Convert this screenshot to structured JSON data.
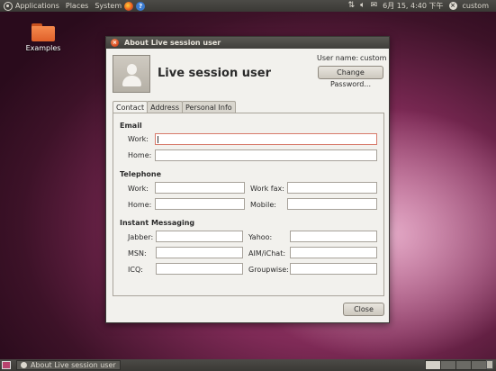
{
  "top_panel": {
    "menus": [
      "Applications",
      "Places",
      "System"
    ],
    "icons": [
      "ubuntu-logo-icon",
      "firefox-icon",
      "help-icon",
      "network-icon",
      "volume-icon",
      "mail-icon",
      "power-icon"
    ],
    "clock": "6月 15, 4:40 下午",
    "user": "custom"
  },
  "desktop": {
    "icons": [
      {
        "label": "Examples",
        "icon": "folder-icon"
      }
    ]
  },
  "dialog": {
    "title": "About Live session user",
    "display_name": "Live session user",
    "username_label": "User name:",
    "username_value": "custom",
    "change_password_label": "Change Password...",
    "tabs": [
      {
        "label": "Contact",
        "active": true
      },
      {
        "label": "Address",
        "active": false
      },
      {
        "label": "Personal Info",
        "active": false
      }
    ],
    "contact": {
      "email_section": "Email",
      "work_label": "Work:",
      "home_label": "Home:",
      "email_work": "",
      "email_home": "",
      "telephone_section": "Telephone",
      "tel_work_label": "Work:",
      "tel_home_label": "Home:",
      "tel_workfax_label": "Work fax:",
      "tel_mobile_label": "Mobile:",
      "im_section": "Instant Messaging",
      "jabber_label": "Jabber:",
      "msn_label": "MSN:",
      "icq_label": "ICQ:",
      "yahoo_label": "Yahoo:",
      "aim_label": "AIM/iChat:",
      "groupwise_label": "Groupwise:"
    },
    "close_label": "Close"
  },
  "bottom_panel": {
    "task_label": "About Live session user",
    "workspaces": 4,
    "active_workspace": 1
  },
  "colors": {
    "panel": "#3f3e3a",
    "desktop_accent": "#b8497f",
    "dialog_bg": "#f2f1ed",
    "close_icon": "#d6461c"
  }
}
